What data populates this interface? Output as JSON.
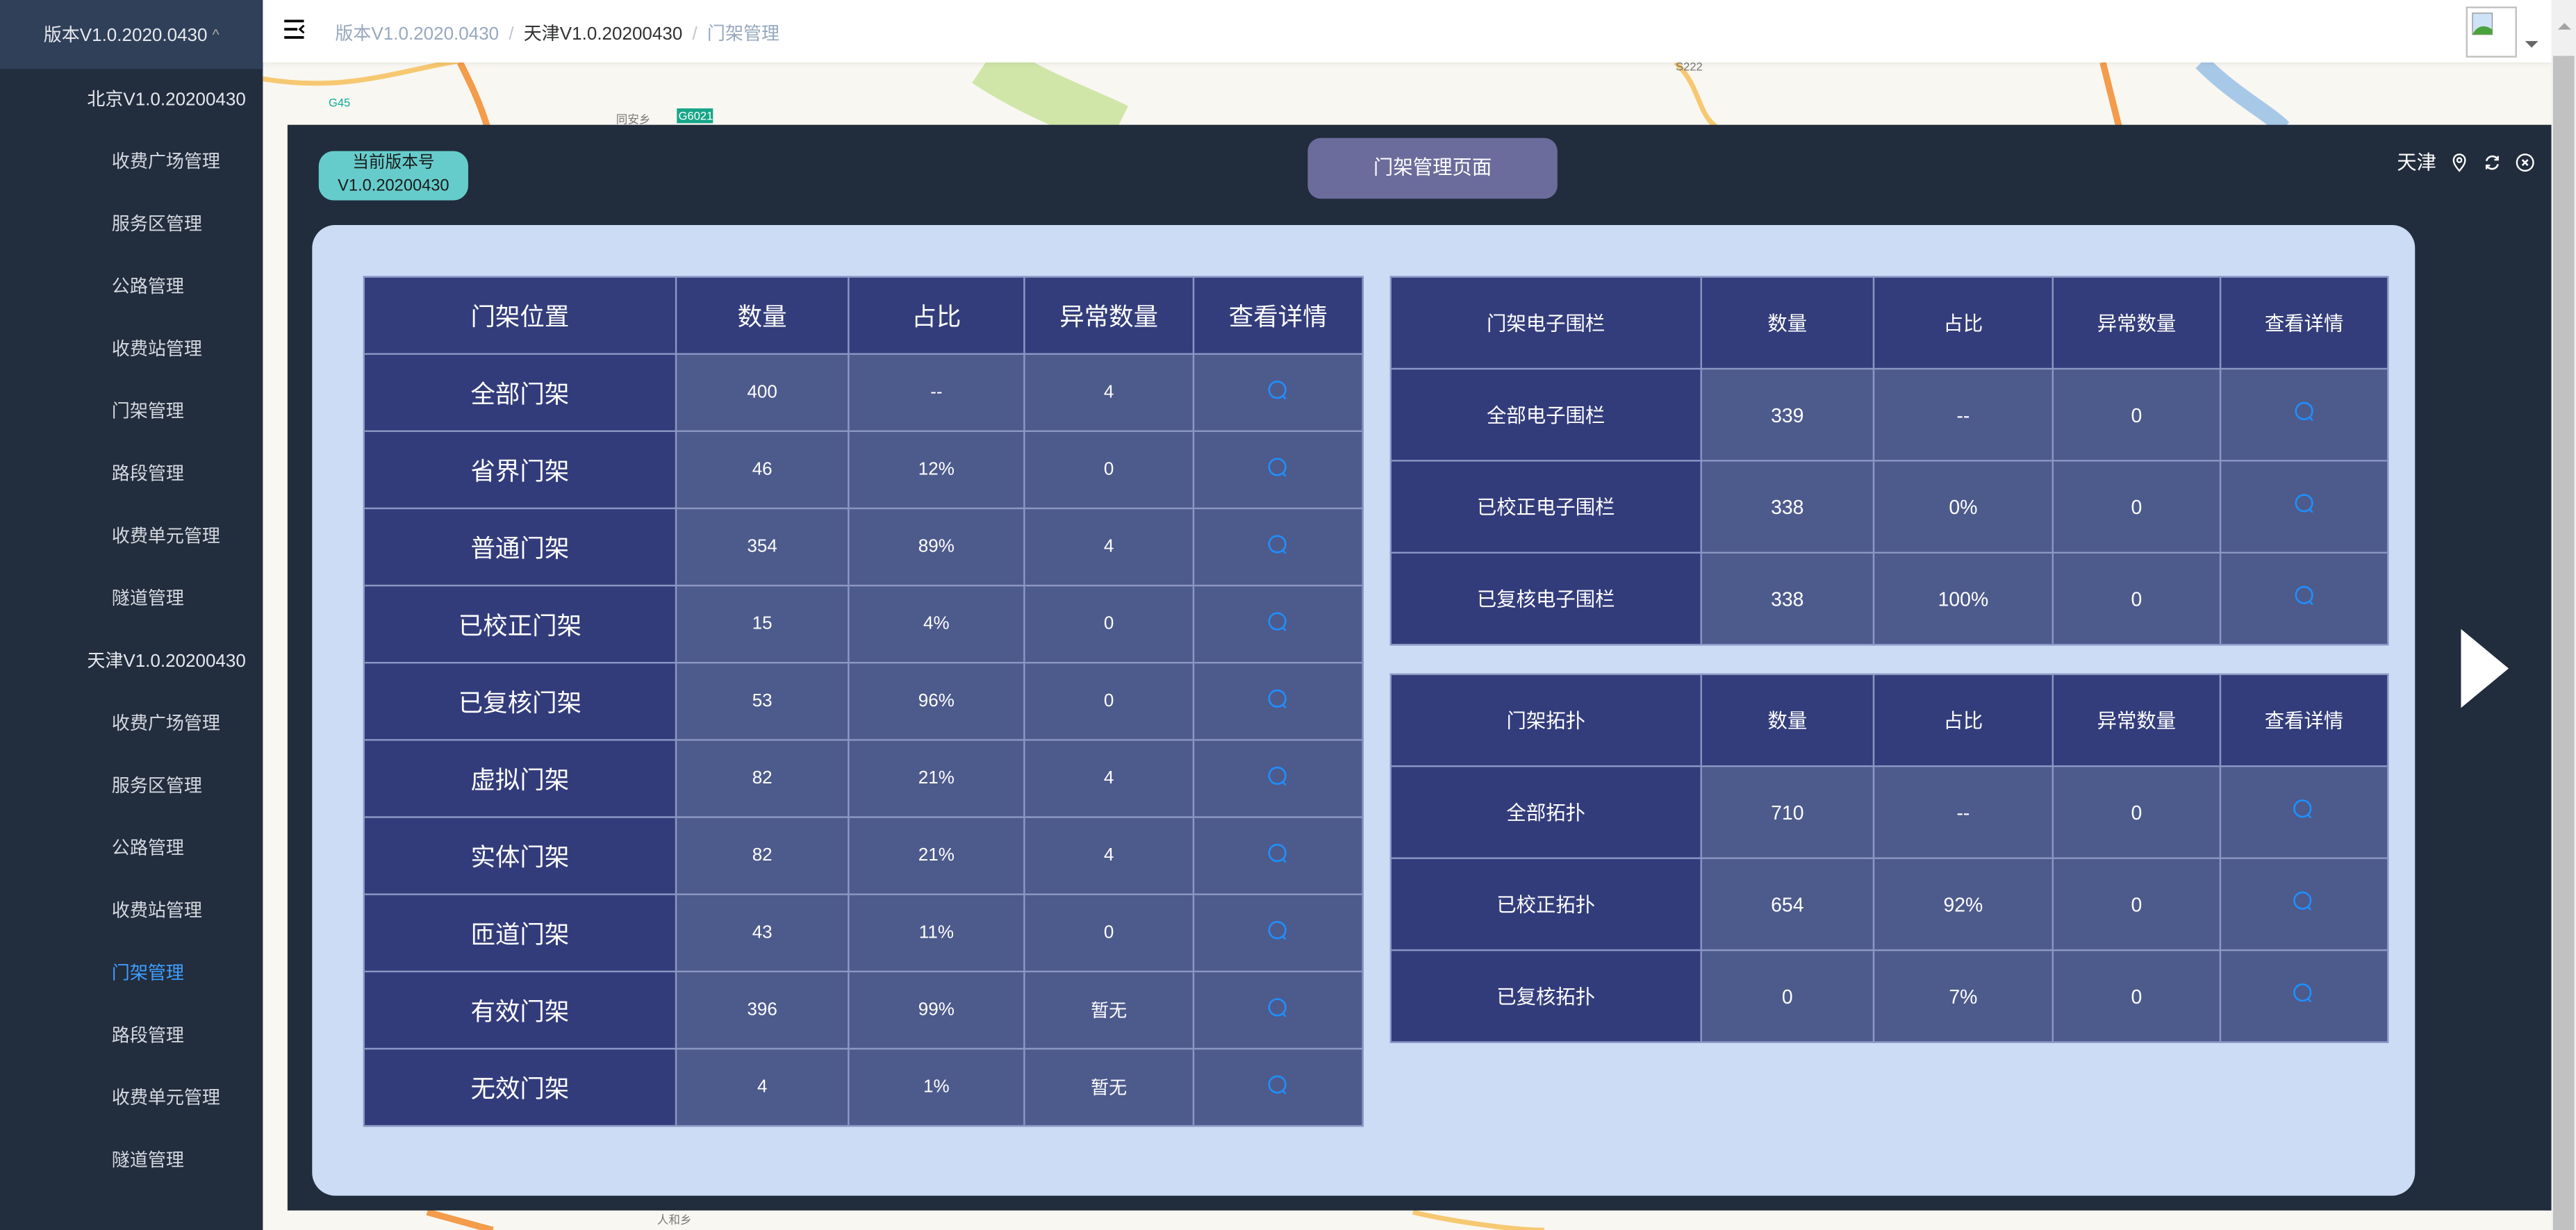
{
  "sidebar": {
    "top": "版本V1.0.2020.0430",
    "groups": [
      {
        "label": "北京V1.0.20200430",
        "items": [
          "收费广场管理",
          "服务区管理",
          "公路管理",
          "收费站管理",
          "门架管理",
          "路段管理",
          "收费单元管理",
          "隧道管理"
        ]
      },
      {
        "label": "天津V1.0.20200430",
        "items": [
          "收费广场管理",
          "服务区管理",
          "公路管理",
          "收费站管理",
          "门架管理",
          "路段管理",
          "收费单元管理",
          "隧道管理"
        ]
      }
    ],
    "active_color": "#409eff"
  },
  "header": {
    "breadcrumb": [
      "版本V1.0.2020.0430",
      "天津V1.0.20200430",
      "门架管理"
    ]
  },
  "panel": {
    "version_label": "当前版本号",
    "version": "V1.0.20200430",
    "title": "门架管理页面",
    "city": "天津"
  },
  "gantry_table": {
    "headers": [
      "门架位置",
      "数量",
      "占比",
      "异常数量",
      "查看详情"
    ],
    "rows": [
      [
        "全部门架",
        "400",
        "--",
        "4"
      ],
      [
        "省界门架",
        "46",
        "12%",
        "0"
      ],
      [
        "普通门架",
        "354",
        "89%",
        "4"
      ],
      [
        "已校正门架",
        "15",
        "4%",
        "0"
      ],
      [
        "已复核门架",
        "53",
        "96%",
        "0"
      ],
      [
        "虚拟门架",
        "82",
        "21%",
        "4"
      ],
      [
        "实体门架",
        "82",
        "21%",
        "4"
      ],
      [
        "匝道门架",
        "43",
        "11%",
        "0"
      ],
      [
        "有效门架",
        "396",
        "99%",
        "暂无"
      ],
      [
        "无效门架",
        "4",
        "1%",
        "暂无"
      ]
    ]
  },
  "fence_table": {
    "headers": [
      "门架电子围栏",
      "数量",
      "占比",
      "异常数量",
      "查看详情"
    ],
    "rows": [
      [
        "全部电子围栏",
        "339",
        "--",
        "0"
      ],
      [
        "已校正电子围栏",
        "338",
        "0%",
        "0"
      ],
      [
        "已复核电子围栏",
        "338",
        "100%",
        "0"
      ]
    ]
  },
  "topology_table": {
    "headers": [
      "门架拓扑",
      "数量",
      "占比",
      "异常数量",
      "查看详情"
    ],
    "rows": [
      [
        "全部拓扑",
        "710",
        "--",
        "0"
      ],
      [
        "已校正拓扑",
        "654",
        "92%",
        "0"
      ],
      [
        "已复核拓扑",
        "0",
        "7%",
        "0"
      ]
    ]
  },
  "map_labels": [
    "G45",
    "G6021",
    "同安乡",
    "S222",
    "人和乡"
  ]
}
